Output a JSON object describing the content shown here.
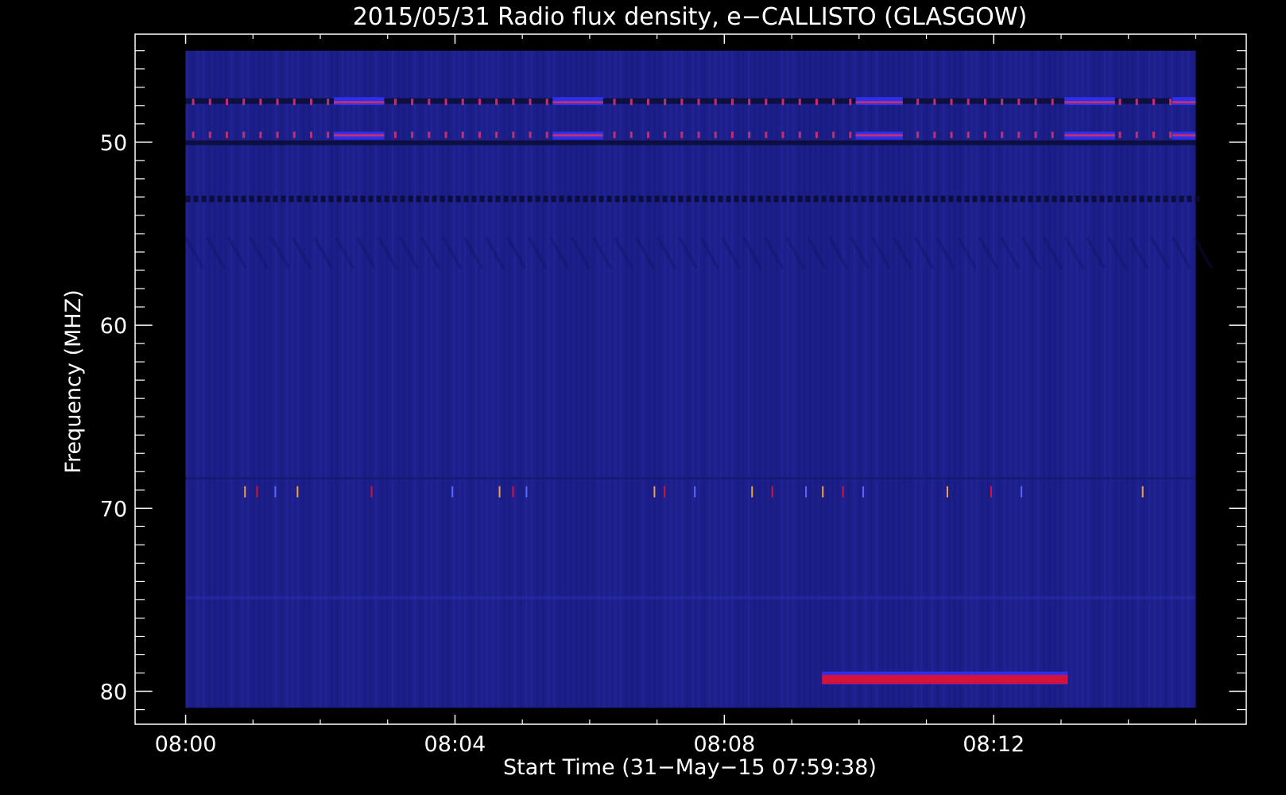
{
  "chart_data": {
    "type": "heatmap",
    "title": "2015/05/31  Radio flux density, e−CALLISTO (GLASGOW)",
    "xlabel": "Start Time (31−May−15 07:59:38)",
    "ylabel": "Frequency (MHZ)",
    "x_ticks": [
      "08:00",
      "08:04",
      "08:08",
      "08:12"
    ],
    "x_tick_minutes": [
      0,
      4,
      8,
      12
    ],
    "y_ticks": [
      "50",
      "60",
      "70",
      "80"
    ],
    "y_tick_values": [
      50,
      60,
      70,
      80
    ],
    "xlim_minutes": [
      -0.75,
      15.75
    ],
    "ylim_mhz": [
      44.1,
      81.8
    ],
    "y_inverted": true,
    "data_extent": {
      "time_minutes": [
        0,
        15
      ],
      "frequency_mhz": [
        45.0,
        80.9
      ]
    },
    "colors": {
      "background": "#1c1f8a",
      "band": "#2a2ff0",
      "dark": "#0b0b2e",
      "burst_red": "#d5123a",
      "burst_magenta": "#c03070",
      "spike_orange": "#f2a23a",
      "spike_blue": "#5a68ff"
    },
    "features": {
      "interference_band_upper_mhz": 47.8,
      "interference_band_lower_mhz": 49.6,
      "block_intervals_minutes": [
        [
          2.2,
          2.95
        ],
        [
          5.45,
          6.2
        ],
        [
          9.95,
          10.65
        ],
        [
          13.05,
          13.8
        ],
        [
          14.65,
          15.0
        ]
      ],
      "dark_stripe_mhz": 53.1,
      "spike_row_mhz": 69.1,
      "spike_minutes": [
        0.87,
        1.05,
        1.32,
        1.65,
        2.75,
        3.95,
        4.65,
        4.85,
        5.05,
        6.95,
        7.1,
        7.55,
        8.4,
        8.7,
        9.2,
        9.45,
        9.75,
        10.05,
        11.3,
        11.95,
        12.4,
        14.2
      ],
      "red_burst": {
        "minutes": [
          9.45,
          13.1
        ],
        "frequency_mhz": [
          79.1,
          79.6
        ]
      }
    }
  }
}
